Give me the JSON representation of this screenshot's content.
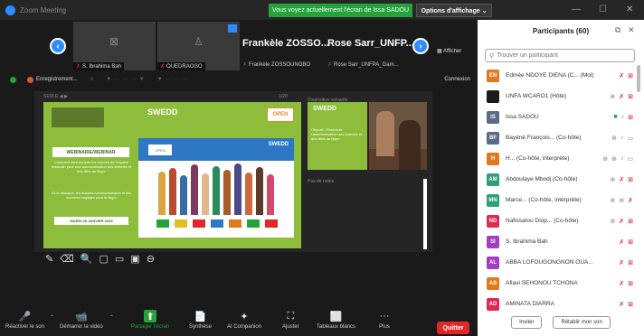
{
  "window": {
    "title": "Zoom Meeting"
  },
  "banner": {
    "text": "Vous voyez actuellement l'écran de Issa SADOU"
  },
  "view_options": {
    "label": "Options d'affichage ⌄"
  },
  "strip": {
    "tiles": [
      {
        "name": "S. Ibrahima Bah"
      },
      {
        "name": "OUEDRAOGO"
      }
    ],
    "named": [
      {
        "big": "Frankèle ZOSSO...",
        "small": "Frankèle ZOSSOUNGBO"
      },
      {
        "big": "Rose Sarr_UNFP...",
        "small": "Rose Sarr_UNFPA_Gam..."
      }
    ],
    "show_label": "Afficher"
  },
  "share_bar": {
    "rec_label": "Enregistrement...",
    "menu1": "≡",
    "menu2": "▼ ···· ···· ···· ▼",
    "menu3": "▼ ···· ···· ····",
    "connexion": "Connexion"
  },
  "slide": {
    "header_left": "SEDLE  ◀  ▶",
    "header_right": "1/20",
    "swedd": "SWEDD",
    "badge": "OPEN",
    "webinar_title": "WEBINAIRE/WEBINAR",
    "text1": "Comment faire évoluer les normes de l'espace masculin pour une autonomisation des femmes et des filles au Niger",
    "text2": "Et le dialogue, les leaders communautaires et les hommes engagés pour le Niger",
    "button": "MARDI 28 JANVIER 2025",
    "illus_label": "SWEDD",
    "illus_badge": "OPEN",
    "notes_header": "Diapositive suivante",
    "mini_title": "SWEDD",
    "mini_text": "Objectif : Renforcer l'autonomisation des femmes et des filles au Niger",
    "notes_label": "Pas de notes"
  },
  "annotation_tools": [
    "✎",
    "⌫",
    "🔍",
    "▢",
    "▭",
    "▣",
    "⊖"
  ],
  "toolbar": {
    "items": [
      {
        "label": "Réactiver le son",
        "icon": "🎤"
      },
      {
        "label": "Démarrer la vidéo",
        "icon": "📹"
      },
      {
        "label": "Partager l'écran",
        "icon": "⬆"
      },
      {
        "label": "Synthèse",
        "icon": "📄"
      },
      {
        "label": "AI Companion",
        "icon": "✦"
      },
      {
        "label": "Ajuster",
        "icon": "⛶"
      },
      {
        "label": "Tableaux blancs",
        "icon": "⬜"
      },
      {
        "label": "Plus",
        "icon": "···"
      }
    ],
    "quit": "Quitter"
  },
  "panel": {
    "title": "Participants (60)",
    "search_placeholder": "Trouver un participant",
    "participants": [
      {
        "initials": "EN",
        "color": "#e07a1f",
        "name": "Edmée NDOYE DIENA (C... (Moi)",
        "icons": [
          "mute",
          "videooff"
        ]
      },
      {
        "initials": "",
        "color": "#1b1b1b",
        "name": "UNFA WCARO1 (Hôte)",
        "icons": [
          "gray",
          "mute",
          "videooff"
        ]
      },
      {
        "initials": "IS",
        "color": "#5a6a8a",
        "name": "Issa SADOU",
        "icons": [
          "green",
          "mic",
          "videooff"
        ]
      },
      {
        "initials": "BF",
        "color": "#5a6a8a",
        "name": "Bayéné François... (Co-hôte)",
        "icons": [
          "gray",
          "mic",
          "video"
        ]
      },
      {
        "initials": "H",
        "color": "#e07a1f",
        "name": "H... (Co-hôte, interprète)",
        "icons": [
          "gray",
          "gray",
          "mic",
          "video"
        ]
      },
      {
        "initials": "AM",
        "color": "#2e9f7a",
        "name": "Abdoulaye Mbodj (Co-hôte)",
        "icons": [
          "gray",
          "mute",
          "videooff"
        ]
      },
      {
        "initials": "MN",
        "color": "#2e9f7a",
        "name": "Marce... (Co-hôte, interprète)",
        "icons": [
          "gray",
          "gray",
          "mute"
        ]
      },
      {
        "initials": "ND",
        "color": "#e02850",
        "name": "Nafissatou Diop... (Co-hôte)",
        "icons": [
          "gray",
          "mute",
          "videooff"
        ]
      },
      {
        "initials": "SI",
        "color": "#a040c0",
        "name": "S. Ibrahima Bah",
        "icons": [
          "mute",
          "videooff"
        ]
      },
      {
        "initials": "AL",
        "color": "#a040c0",
        "name": "ABBA LOFOUGONGNON OUA...",
        "icons": [
          "mute",
          "videooff"
        ]
      },
      {
        "initials": "AS",
        "color": "#e07a1f",
        "name": "Afiavi SEHONOU TCHONA",
        "icons": [
          "mute",
          "videooff"
        ]
      },
      {
        "initials": "AD",
        "color": "#e02850",
        "name": "AMINATA DIARRA",
        "icons": [
          "mute",
          "videooff"
        ]
      }
    ],
    "invite": "Inviter",
    "unmute_all": "Rétablir mon son"
  }
}
